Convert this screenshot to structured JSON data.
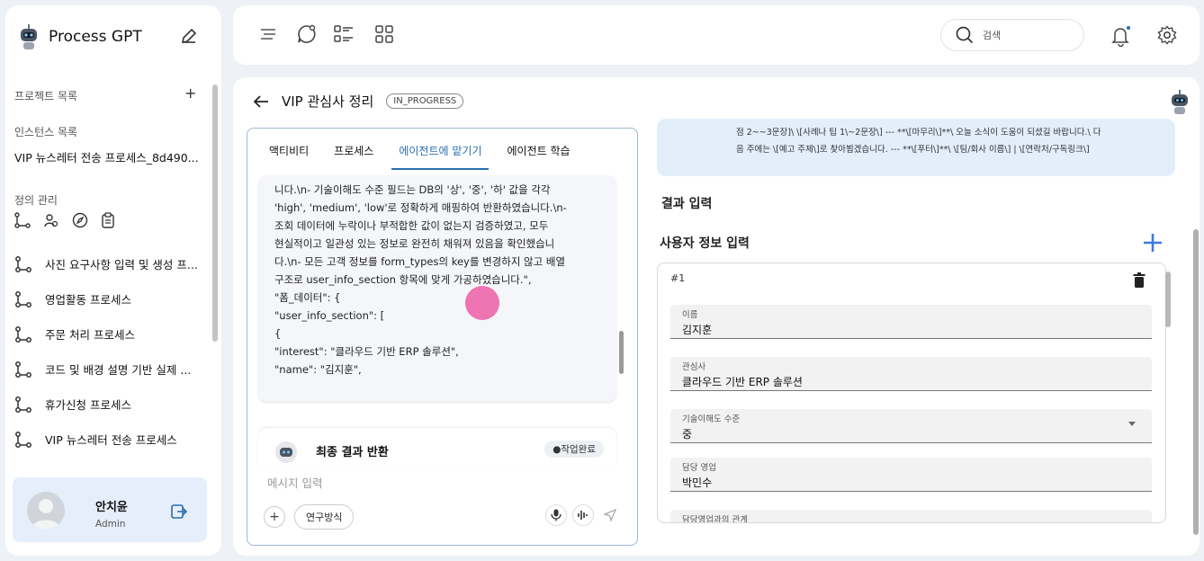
{
  "sidebar": {
    "brand": "Process GPT",
    "projects_label": "프로젝트 목록",
    "instances_label": "인스턴스 목록",
    "instance_item": "VIP 뉴스레터 전송 프로세스_8d490...",
    "definitions_label": "정의 관리",
    "processes": [
      "사진 요구사항 입력 및 생성 프...",
      "영업활동 프로세스",
      "주문 처리 프로세스",
      "코드 및 배경 설명 기반 실제 ...",
      "휴가신청 프로세스",
      "VIP 뉴스레터 전송 프로세스"
    ],
    "user_name": "안치윤",
    "user_role": "Admin"
  },
  "topbar": {
    "search_placeholder": "검색"
  },
  "main": {
    "title": "VIP 관심사 정리",
    "status": "IN_PROGRESS",
    "tabs": [
      "액티비티",
      "프로세스",
      "에이전트에 맡기기",
      "에이전트 학습"
    ],
    "active_tab": "에이전트에 맡기기",
    "message_lines": [
      "니다.\\n- 기술이해도 수준 필드는 DB의 '상', '중', '하' 값을 각각",
      "'high', 'medium', 'low'로 정확하게 매핑하여 반환하였습니다.\\n-",
      "조회 데이터에 누락이나 부적합한 값이 없는지 검증하였고, 모두",
      "현실적이고 일관성 있는 정보로 완전히 채워져 있음을 확인했습니",
      "다.\\n- 모든 고객 정보를 form_types의 key를 변경하지 않고 배열",
      "구조로 user_info_section 항목에 맞게 가공하였습니다.\",",
      "\"폼_데이터\": {",
      "\"user_info_section\": [",
      "{",
      "\"interest\": \"클라우드 기반 ERP 솔루션\",",
      "\"name\": \"김지훈\","
    ],
    "final_title": "최종 결과 반환",
    "final_status": "●작업완료",
    "message_placeholder": "메시지 입력",
    "research_button": "연구방식",
    "info_lines": [
      "점 2~~3문장]\\ \\[사례나 팁 1\\~2문장\\] --- **\\[마무리\\]**\\ 오늘 소식이 도움이 되셨길 바랍니다.\\ 다",
      "음 주에는 \\[예고 주제\\]로 찾아뵙겠습니다. --- **\\[푸터\\]**\\ \\[팀/회사 이름\\] | \\[연락처/구독링크\\]"
    ],
    "result_heading": "결과 입력",
    "user_info_heading": "사용자 정보 입력",
    "entry_number": "#1",
    "fields": [
      {
        "label": "이름",
        "value": "김지훈"
      },
      {
        "label": "관심사",
        "value": "클라우드 기반 ERP 솔루션"
      },
      {
        "label": "기술이해도 수준",
        "value": "중"
      },
      {
        "label": "담당 영업",
        "value": "박민수"
      },
      {
        "label": "담당영업과의 관계",
        "value": ""
      }
    ]
  },
  "colors": {
    "accent": "#2b6cb0",
    "user_card_bg": "#e5eefa",
    "info_box_bg": "#e3eefb",
    "add_icon": "#3c7be0"
  },
  "icons": [
    "robot-logo-icon",
    "edit-icon",
    "plus-icon",
    "menu-icon",
    "chat-icon",
    "list-icon",
    "grid-icon",
    "search-icon",
    "bell-icon",
    "gear-icon",
    "back-arrow-icon",
    "trash-icon",
    "mic-icon",
    "waveform-icon",
    "send-icon",
    "logout-icon"
  ]
}
